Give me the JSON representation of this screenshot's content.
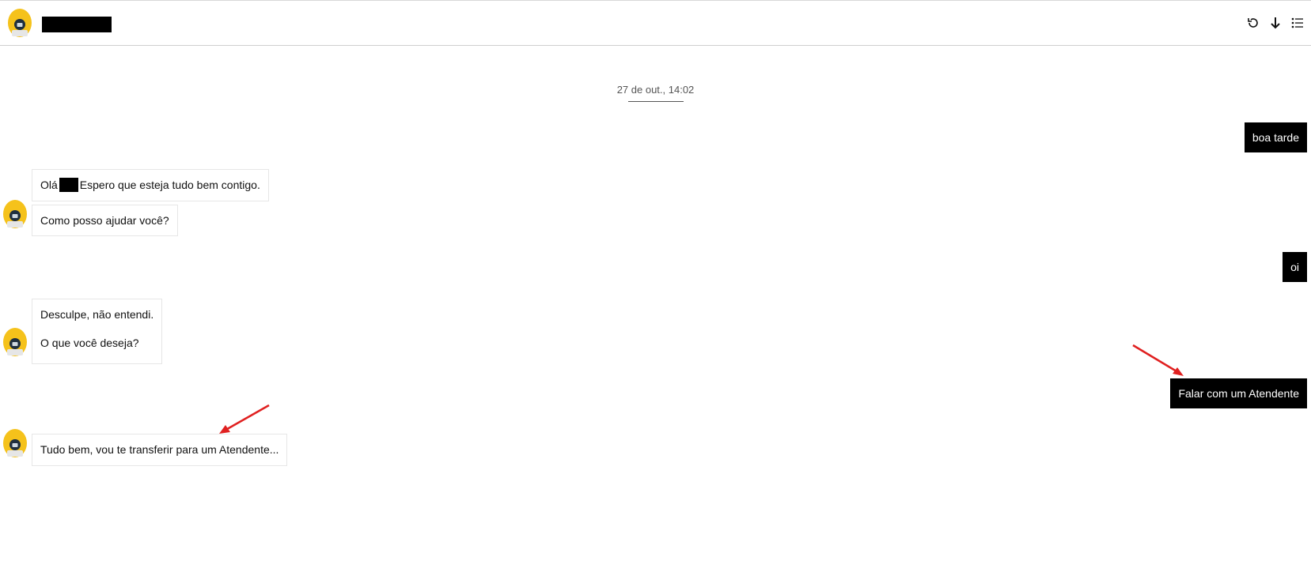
{
  "header": {
    "avatar_icon": "bot-avatar-icon",
    "title_redacted": true,
    "tools": [
      {
        "name": "refresh-icon",
        "glyph": "↻"
      },
      {
        "name": "download-icon",
        "glyph": "↓"
      },
      {
        "name": "list-icon",
        "glyph": "☰"
      }
    ]
  },
  "conversation": {
    "date": "27 de out., 14:02",
    "messages": {
      "user_1": "boa tarde",
      "bot_1a_before": "Olá",
      "bot_1a_after": "Espero que esteja tudo bem contigo.",
      "bot_1b": "Como posso ajudar você?",
      "user_2": "oi",
      "bot_2_line1": "Desculpe, não entendi.",
      "bot_2_line2": "O que você deseja?",
      "user_3": "Falar com um Atendente",
      "bot_3": "Tudo bem, vou te transferir para um Atendente..."
    }
  },
  "colors": {
    "avatar_yellow": "#f5c21b",
    "avatar_dark": "#1f2f3f",
    "user_bubble": "#000000",
    "annotation_arrow": "#e02020"
  }
}
